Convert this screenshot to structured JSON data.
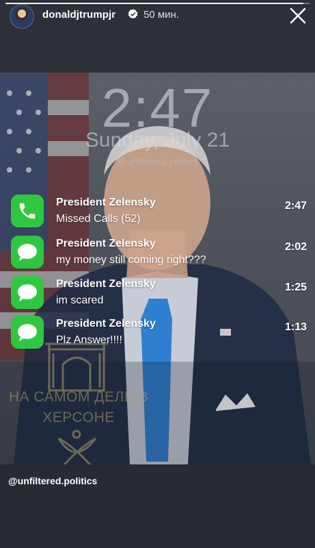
{
  "header": {
    "username": "donaldjtrumpjr",
    "time_ago": "50 мин.",
    "progress": 0.98
  },
  "lockscreen": {
    "time": "2:47",
    "date": "Sunday, July 21",
    "handle": "@unfiltered.politics"
  },
  "notifications": [
    {
      "app": "phone-icon",
      "sender": "President Zelensky",
      "message": "Missed Calls (52)",
      "time": "2:47"
    },
    {
      "app": "messages-icon",
      "sender": "President Zelensky",
      "message": "my money still coming right???",
      "time": "2:02"
    },
    {
      "app": "messages-icon",
      "sender": "President Zelensky",
      "message": "im scared",
      "time": "1:25"
    },
    {
      "app": "messages-icon",
      "sender": "President Zelensky",
      "message": "Plz Answer!!!!",
      "time": "1:13"
    }
  ],
  "watermark": {
    "line1": "НА САМОМ ДЕЛЕ В",
    "line2": "ХЕРСОНЕ"
  },
  "credit": "@unfiltered.politics",
  "colors": {
    "app_green": "#2dc840",
    "tie_blue": "#2f7fd0",
    "watermark_gold": "#aaa06e"
  }
}
